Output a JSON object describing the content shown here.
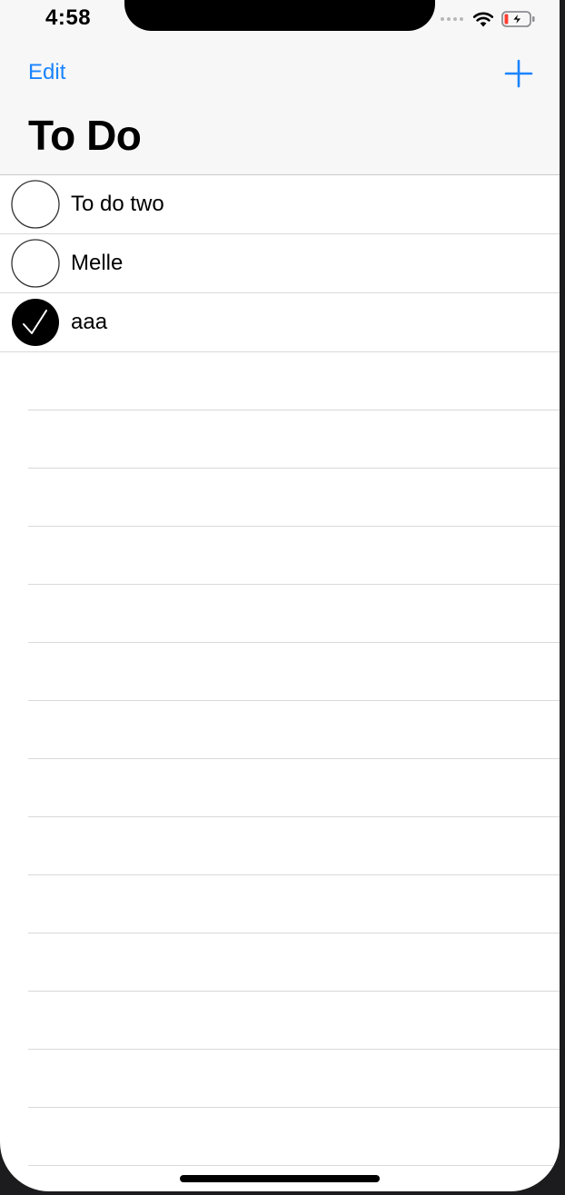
{
  "status_bar": {
    "time": "4:58",
    "icons": [
      "signal-dots-icon",
      "wifi-icon",
      "battery-charging-icon"
    ],
    "battery_level_fraction": 0.15
  },
  "nav": {
    "edit_label": "Edit",
    "add_icon": "plus-icon",
    "title": "To Do"
  },
  "todos": [
    {
      "label": "To do two",
      "done": false
    },
    {
      "label": "Melle",
      "done": false
    },
    {
      "label": "aaa",
      "done": true
    }
  ],
  "colors": {
    "accent": "#1a84ff",
    "nav_background": "#f7f7f7",
    "separator": "#d9d9dc",
    "checked_fill": "#000000",
    "battery_low": "#ff3b30"
  }
}
